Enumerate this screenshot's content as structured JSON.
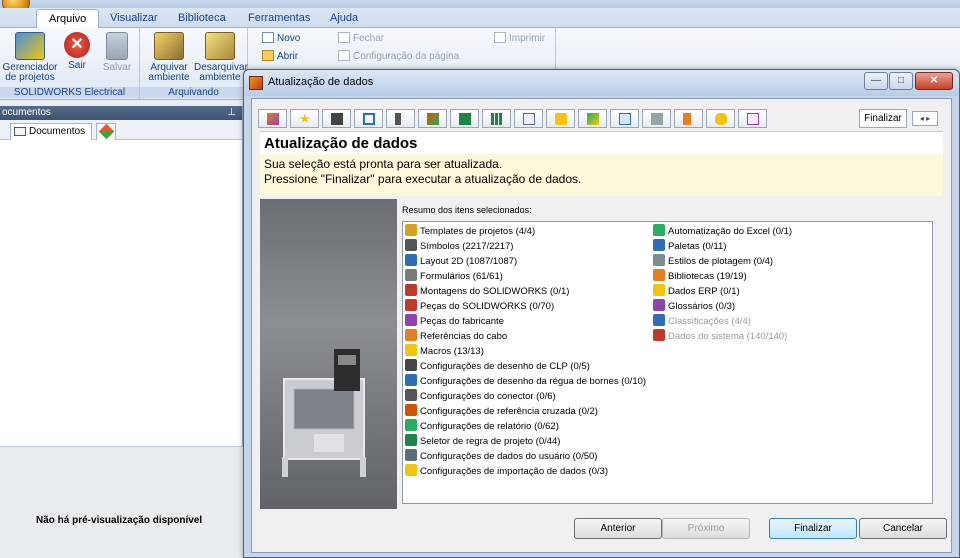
{
  "app": {
    "title": "SOLIDWORKS Electrical"
  },
  "ribbon": {
    "tabs": [
      {
        "label": "Arquivo",
        "active": true
      },
      {
        "label": "Visualizar"
      },
      {
        "label": "Biblioteca"
      },
      {
        "label": "Ferramentas"
      },
      {
        "label": "Ajuda"
      }
    ],
    "groups": {
      "electrical": {
        "label": "SOLIDWORKS Electrical",
        "buttons": [
          {
            "label": "Gerenciador de projetos",
            "icon": "project-manager-icon"
          },
          {
            "label": "Sair",
            "icon": "exit-icon"
          },
          {
            "label": "Salvar",
            "icon": "save-icon",
            "disabled": true
          }
        ]
      },
      "ambiente": {
        "label": "Arquivando",
        "buttons": [
          {
            "label": "Arquivar ambiente",
            "icon": "archive-env-icon"
          },
          {
            "label": "Desarquivar ambiente",
            "icon": "unarchive-env-icon"
          }
        ]
      },
      "documento": {
        "items": [
          {
            "label": "Novo",
            "icon": "new-doc-icon"
          },
          {
            "label": "Abrir",
            "icon": "open-folder-icon"
          },
          {
            "label": "Fechar",
            "icon": "close-doc-icon",
            "disabled": true
          },
          {
            "label": "Configuração da página",
            "icon": "page-setup-icon",
            "disabled": true
          },
          {
            "label": "Imprimir",
            "icon": "print-icon",
            "disabled": true
          }
        ]
      }
    }
  },
  "docs_panel": {
    "header": "ocumentos",
    "tab_label": "Documentos",
    "preview_text": "Não há pré-visualização disponível"
  },
  "dialog": {
    "title": "Atualização de dados",
    "final_step_label": "Finalizar",
    "heading": "Atualização de dados",
    "line1": "Sua seleção está pronta para ser atualizada.",
    "line2": "Pressione \"Finalizar\" para executar a atualização de dados.",
    "summary_label": "Resumo dos itens selecionados:",
    "summary_left": [
      {
        "label": "Templates de projetos (4/4)",
        "icon": "templates-icon",
        "color": "#d9a21b"
      },
      {
        "label": "Símbolos (2217/2217)",
        "icon": "symbols-icon",
        "color": "#555555"
      },
      {
        "label": "Layout 2D (1087/1087)",
        "icon": "layout-2d-icon",
        "color": "#2f6db4"
      },
      {
        "label": "Formulários (61/61)",
        "icon": "forms-icon",
        "color": "#7a7a7a"
      },
      {
        "label": "Montagens do SOLIDWORKS (0/1)",
        "icon": "assembly-icon",
        "color": "#c0392b"
      },
      {
        "label": "Peças do SOLIDWORKS (0/70)",
        "icon": "part-icon",
        "color": "#c0392b"
      },
      {
        "label": "Peças do fabricante",
        "icon": "manufacturer-parts-icon",
        "color": "#8e44ad"
      },
      {
        "label": "Referências do cabo",
        "icon": "cable-ref-icon",
        "color": "#e67e22"
      },
      {
        "label": "Macros (13/13)",
        "icon": "macros-star-icon",
        "color": "#f1c40f"
      },
      {
        "label": "Configurações de desenho de CLP (0/5)",
        "icon": "plc-config-icon",
        "color": "#444444"
      },
      {
        "label": "Configurações de desenho da régua de bornes (0/10)",
        "icon": "terminal-config-icon",
        "color": "#2f6db4"
      },
      {
        "label": "Configurações do conector (0/6)",
        "icon": "connector-config-icon",
        "color": "#555555"
      },
      {
        "label": "Configurações de referência cruzada (0/2)",
        "icon": "cross-ref-icon",
        "color": "#d35400"
      },
      {
        "label": "Configurações de relatório (0/62)",
        "icon": "report-config-icon",
        "color": "#27ae60"
      },
      {
        "label": "Seletor de regra de projeto (0/44)",
        "icon": "rule-selector-icon",
        "color": "#1e8449"
      },
      {
        "label": "Configurações de dados do usuário (0/50)",
        "icon": "user-data-icon",
        "color": "#5d6d7e"
      },
      {
        "label": "Configurações de importação de dados (0/3)",
        "icon": "import-data-icon",
        "color": "#f1c40f"
      }
    ],
    "summary_right": [
      {
        "label": "Automatização do Excel (0/1)",
        "icon": "excel-automation-icon",
        "color": "#27ae60"
      },
      {
        "label": "Paletas (0/11)",
        "icon": "palettes-icon",
        "color": "#2f6db4"
      },
      {
        "label": "Estilos de plotagem (0/4)",
        "icon": "plot-styles-icon",
        "color": "#7f8c8d"
      },
      {
        "label": "Bibliotecas (19/19)",
        "icon": "libraries-icon",
        "color": "#e67e22"
      },
      {
        "label": "Dados ERP (0/1)",
        "icon": "erp-data-icon",
        "color": "#f1c40f"
      },
      {
        "label": "Glossários (0/3)",
        "icon": "glossary-icon",
        "color": "#8e44ad"
      },
      {
        "label": "Classificações (4/4)",
        "icon": "classifications-icon",
        "color": "#2f6db4",
        "dim": true
      },
      {
        "label": "Dados do sistema (140/140)",
        "icon": "system-data-icon",
        "color": "#c0392b",
        "dim": true
      }
    ],
    "buttons": {
      "back": "Anterior",
      "next": "Próximo",
      "finish": "Finalizar",
      "cancel": "Cancelar"
    }
  }
}
